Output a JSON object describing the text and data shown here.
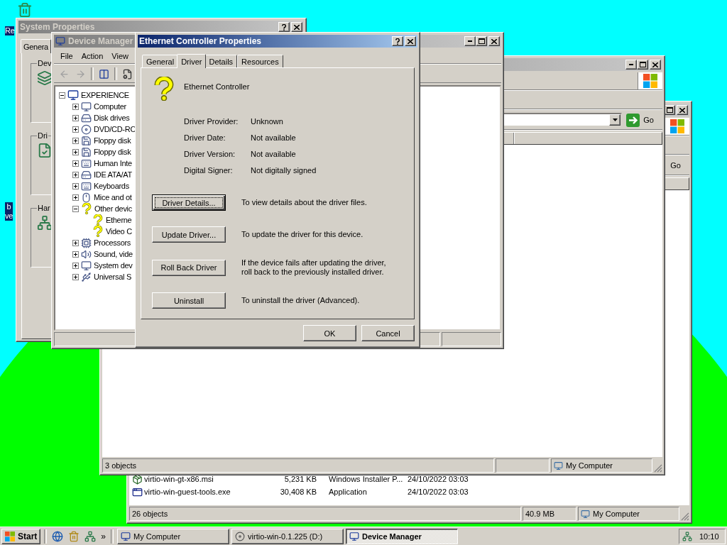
{
  "desktop_icons": [
    {
      "lines": [
        "Re"
      ]
    },
    {
      "lines": [
        "b",
        "ve"
      ]
    }
  ],
  "folder_window": {
    "active": false,
    "go_label": "Go",
    "files": [
      {
        "kind": "installer",
        "name": "virtio-win-gt-x86.msi",
        "size": "5,231 KB",
        "type": "Windows Installer P...",
        "date": "24/10/2022 03:03"
      },
      {
        "kind": "application",
        "name": "virtio-win-guest-tools.exe",
        "size": "30,408 KB",
        "type": "Application",
        "date": "24/10/2022 03:03"
      }
    ],
    "status": {
      "objects": "26 objects",
      "size": "40.9 MB",
      "zone": "My Computer"
    }
  },
  "computer_window": {
    "active": false,
    "go_label": "Go",
    "status": {
      "objects": "3 objects",
      "zone": "My Computer"
    }
  },
  "system_properties": {
    "active": false,
    "title": "System Properties",
    "tabs": [
      {
        "label": "Genera",
        "selected": true
      }
    ],
    "groups": [
      "Dev",
      "Dri",
      "Har"
    ]
  },
  "device_manager": {
    "active": false,
    "title": "Device Manager",
    "menu": [
      "File",
      "Action",
      "View"
    ],
    "tree": {
      "label": "EXPERIENCE",
      "expanded": true,
      "children": [
        {
          "label": "Computer",
          "expanded": false
        },
        {
          "label": "Disk drives",
          "expanded": false
        },
        {
          "label": "DVD/CD-RO",
          "expanded": false
        },
        {
          "label": "Floppy disk",
          "expanded": false
        },
        {
          "label": "Floppy disk",
          "expanded": false
        },
        {
          "label": "Human Inte",
          "expanded": false
        },
        {
          "label": "IDE ATA/AT",
          "expanded": false
        },
        {
          "label": "Keyboards",
          "expanded": false
        },
        {
          "label": "Mice and ot",
          "expanded": false
        },
        {
          "label": "Other devic",
          "kind": "unknown",
          "expanded": true,
          "children": [
            {
              "label": "Etherne",
              "kind": "unknown"
            },
            {
              "label": "Video C",
              "kind": "unknown"
            }
          ]
        },
        {
          "label": "Processors",
          "expanded": false
        },
        {
          "label": "Sound, vide",
          "expanded": false
        },
        {
          "label": "System dev",
          "expanded": false
        },
        {
          "label": "Universal S",
          "expanded": false
        }
      ]
    }
  },
  "dialog": {
    "active": true,
    "title": "Ethernet Controller Properties",
    "tabs": [
      {
        "label": "General",
        "selected": false
      },
      {
        "label": "Driver",
        "selected": true
      },
      {
        "label": "Details",
        "selected": false
      },
      {
        "label": "Resources",
        "selected": false
      }
    ],
    "device_name": "Ethernet Controller",
    "fields": [
      {
        "label": "Driver Provider:",
        "value": "Unknown"
      },
      {
        "label": "Driver Date:",
        "value": "Not available"
      },
      {
        "label": "Driver Version:",
        "value": "Not available"
      },
      {
        "label": "Digital Signer:",
        "value": "Not digitally signed"
      }
    ],
    "actions": [
      {
        "button": "Driver Details...",
        "description": "To view details about the driver files.",
        "focused": true
      },
      {
        "button": "Update Driver...",
        "description": "To update the driver for this device.",
        "focused": false
      },
      {
        "button": "Roll Back Driver",
        "description": "If the device fails after updating the driver, roll back to the previously installed driver.",
        "focused": false
      },
      {
        "button": "Uninstall",
        "description": "To uninstall the driver (Advanced).",
        "focused": false
      }
    ],
    "buttons": [
      "OK",
      "Cancel"
    ]
  },
  "taskbar": {
    "start": "Start",
    "chevron": "»",
    "tasks": [
      {
        "label": "My Computer",
        "selected": false
      },
      {
        "label": "virtio-win-0.1.225 (D:)",
        "selected": false
      },
      {
        "label": "Device Manager",
        "selected": true
      }
    ],
    "clock": "10:10"
  }
}
